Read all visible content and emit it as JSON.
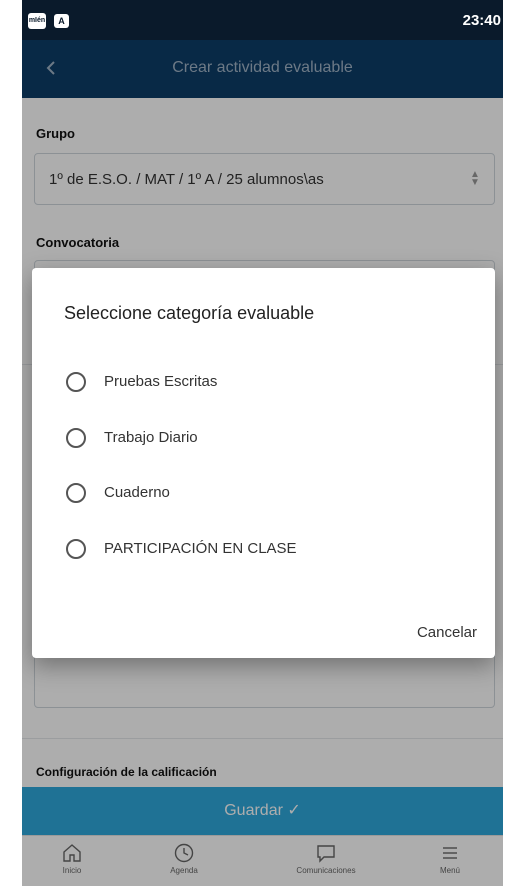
{
  "status_bar": {
    "icon_1": "mIén",
    "icon_2": "A",
    "time": "23:40"
  },
  "app_bar": {
    "title": "Crear actividad evaluable",
    "back_icon": "chevron-left-icon"
  },
  "form": {
    "group_label": "Grupo",
    "group_value": "1º de E.S.O. / MAT / 1º A / 25 alumnos\\as",
    "convocatoria_label": "Convocatoria",
    "config_label": "Configuración de la calificación"
  },
  "save_button": {
    "label": "Guardar ✓"
  },
  "bottom_nav": {
    "items": [
      {
        "label": "Inicio",
        "icon": "home-icon"
      },
      {
        "label": "Agenda",
        "icon": "clock-icon"
      },
      {
        "label": "Comunicaciones",
        "icon": "chat-icon"
      },
      {
        "label": "Menú",
        "icon": "menu-icon"
      }
    ]
  },
  "dialog": {
    "title": "Seleccione categoría evaluable",
    "options": [
      {
        "label": "Pruebas Escritas"
      },
      {
        "label": "Trabajo Diario"
      },
      {
        "label": "Cuaderno"
      },
      {
        "label": "PARTICIPACIÓN EN CLASE"
      }
    ],
    "cancel_label": "Cancelar"
  },
  "colors": {
    "status_bar": "#0a1a2b",
    "app_bar": "#0c3d68",
    "save_bar": "#2ea8dc"
  }
}
